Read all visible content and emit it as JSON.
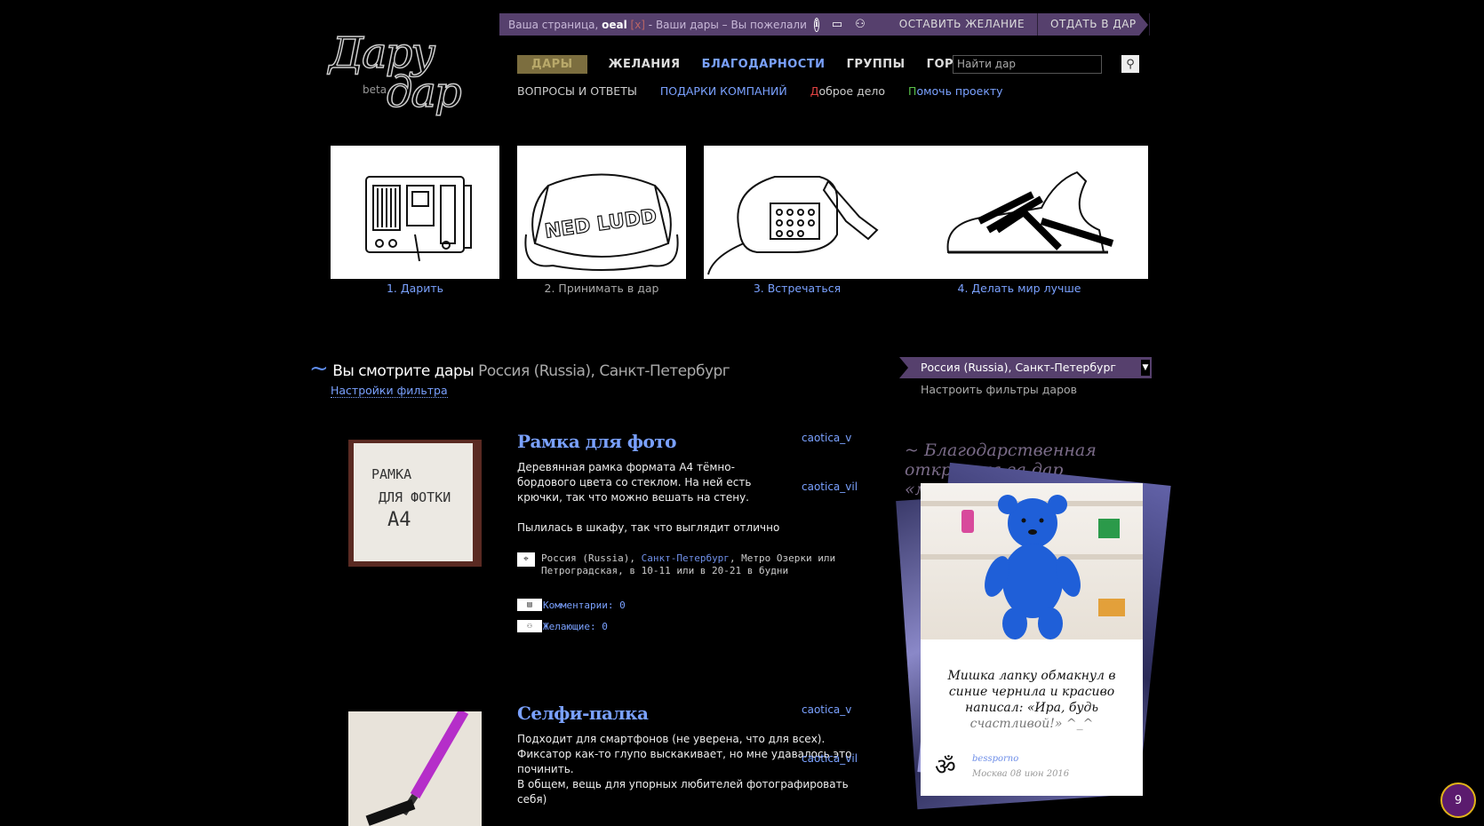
{
  "userbar": {
    "prefix": "Ваша страница, ",
    "username": "oeal",
    "close": "[x]",
    "links": " - Ваши дары – Вы пожелали",
    "btn_wish": "ОСТАВИТЬ ЖЕЛАНИЕ",
    "btn_give": "ОТДАТЬ В ДАР"
  },
  "logo": {
    "line1": "Дару",
    "line2": "дар",
    "beta": "beta"
  },
  "nav_main": [
    "ДАРЫ",
    "ЖЕЛАНИЯ",
    "БЛАГОДАРНОСТИ",
    "ГРУППЫ",
    "ГОРОДА"
  ],
  "search": {
    "placeholder": "Найти дар"
  },
  "nav_secondary": {
    "faq": "ВОПРОСЫ И ОТВЕТЫ",
    "companies": "ПОДАРКИ КОМПАНИЙ",
    "good_first": "Д",
    "good_rest": "оброе дело",
    "help_first": "П",
    "help_rest": "омочь проекту"
  },
  "steps": [
    "1. Дарить",
    "2. Принимать в дар",
    "3. Встречаться",
    "4. Делать мир лучше"
  ],
  "step_art": {
    "bag_text": "NED LUDD"
  },
  "heading": {
    "prefix": "Вы смотрите дары",
    "location": "Россия (Russia), Санкт-Петербург",
    "filter_link": "Настройки фильтра"
  },
  "region": {
    "selected": "Россия (Russia), Санкт-Петербург",
    "filter_label": "Настроить фильтры даров"
  },
  "gifts": [
    {
      "title": "Рамка для фото",
      "photo_text": [
        "РАМКА",
        "ДЛЯ ФОТКИ",
        "А4"
      ],
      "description": "Деревянная рамка формата А4 тёмно-бордового цвета со стеклом. На ней есть крючки, так что можно вешать на стену.\n\nПылилась в шкафу, так что выглядит отлично",
      "user1": "caotica_v",
      "user2": "caotica_vil",
      "loc_country": "Россия (Russia)",
      "loc_city": "Санкт-Петербург",
      "loc_rest": ", Метро Озерки или Петроградская, в 10-11 или в 20-21 в будни",
      "comments": "Комментарии: 0",
      "wishers": "Желающие: 0"
    },
    {
      "title": "Селфи-палка",
      "description": "Подходит для смартфонов (не уверена, что для всех).\nФиксатор как-то глупо выскакивает, но мне удавалось это починить.\nВ общем, вещь для упорных любителей фотографировать себя)",
      "user1": "caotica_v",
      "user2": "caotica_vil"
    }
  ],
  "thanks": {
    "heading": "~ Благодарственная открытка за дар «мишка»",
    "text": "Мишка лапку обмакнул в синие чернила и красиво написал: «Ира, будь",
    "text_faint": "счастливой!» ^_^",
    "user": "bessporno",
    "meta": "Москва  08 июн 2016"
  },
  "badge": "9",
  "colors": {
    "accent_blue": "#7aa1ff",
    "bar_purple": "#56406d",
    "active_nav": "#7c6e3f"
  }
}
